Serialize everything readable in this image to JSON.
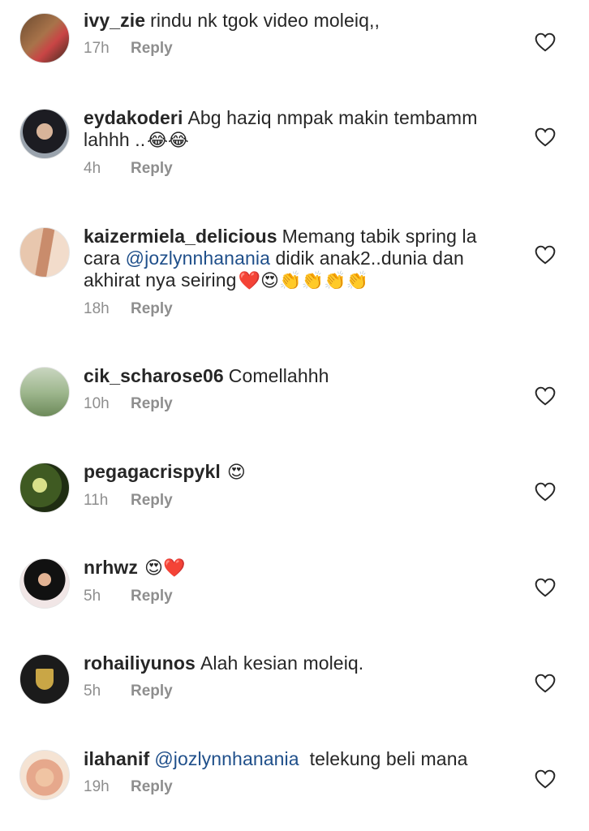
{
  "comments": [
    {
      "user": "ivy_zie",
      "text": "rindu nk tgok video moleiq,,",
      "time": "17h",
      "reply": "Reply"
    },
    {
      "user": "eydakoderi",
      "text": "Abg haziq nmpak makin tembamm lahhh ..",
      "emoji": "😂😂",
      "time": "4h",
      "reply": "Reply"
    },
    {
      "user": "kaizermiela_delicious",
      "text_before": "Memang tabik spring la cara",
      "mention": "@jozlynnhanania",
      "text_after": "didik anak2..dunia dan akhirat nya seiring",
      "emoji": "❤️😍👏👏👏👏",
      "time": "18h",
      "reply": "Reply"
    },
    {
      "user": "cik_scharose06",
      "text": "Comellahhh",
      "time": "10h",
      "reply": "Reply"
    },
    {
      "user": "pegagacrispykl",
      "emoji": "😍",
      "time": "11h",
      "reply": "Reply"
    },
    {
      "user": "nrhwz",
      "emoji": "😍❤️",
      "time": "5h",
      "reply": "Reply"
    },
    {
      "user": "rohailiyunos",
      "text": "Alah kesian moleiq.",
      "time": "5h",
      "reply": "Reply"
    },
    {
      "user": "ilahanif",
      "mention": "@jozlynnhanania",
      "text": "telekung beli mana",
      "time": "19h",
      "reply": "Reply"
    }
  ],
  "icons": {
    "like": "heart-outline-icon"
  },
  "colors": {
    "text": "#262626",
    "meta": "#8e8e8e",
    "mention": "#1f4f8a"
  }
}
